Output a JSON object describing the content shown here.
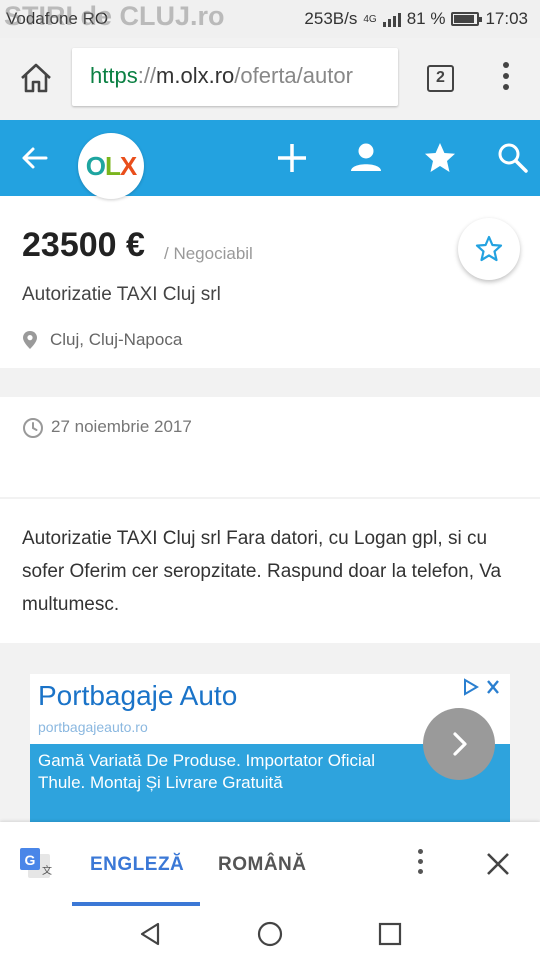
{
  "status_bar": {
    "carrier": "Vodafone RO",
    "watermark": "STIRI de CLUJ.ro",
    "speed": "253B/s",
    "network": "4G",
    "battery": "81 %",
    "time": "17:03"
  },
  "browser": {
    "url_scheme": "https",
    "url_sep": "://",
    "url_host": "m.olx.ro",
    "url_path": "/oferta/autor",
    "tab_count": "2"
  },
  "app": {
    "logo_o": "O",
    "logo_l": "L",
    "logo_x": "X",
    "colors": {
      "header": "#23a2e0",
      "logo_o": "#1ea5a0",
      "logo_l": "#7ab51d",
      "logo_x": "#e94e1b"
    }
  },
  "listing": {
    "price": "23500 €",
    "negotiable": "/ Negociabil",
    "title": "Autorizatie TAXI Cluj srl",
    "location": "Cluj, Cluj-Napoca",
    "date": "27 noiembrie 2017",
    "description": "Autorizatie TAXI Cluj srl Fara datori, cu Logan gpl, si cu sofer Oferim cer seropzitate. Raspund doar la telefon, Va multumesc."
  },
  "ad": {
    "title": "Portbagaje Auto",
    "url": "portbagajeauto.ro",
    "text": "Gamă Variată De Produse. Importator Oficial Thule. Montaj Și Livrare Gratuită"
  },
  "translate_bar": {
    "lang_source": "ENGLEZĂ",
    "lang_target": "ROMÂNĂ"
  }
}
